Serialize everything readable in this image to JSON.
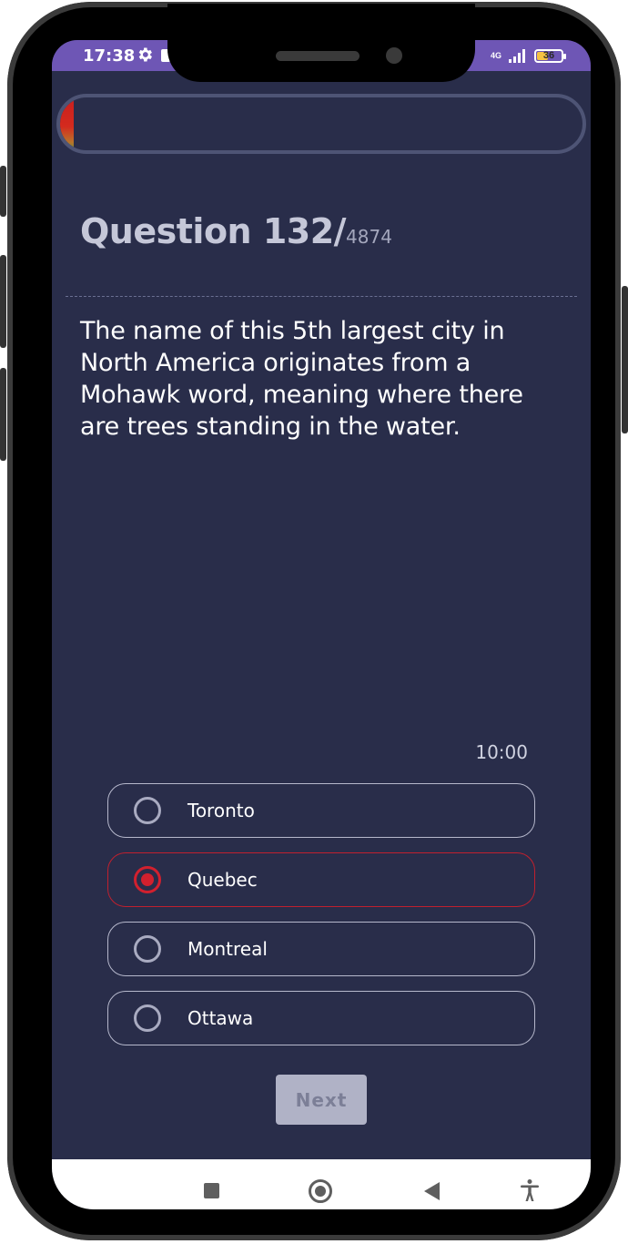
{
  "status_bar": {
    "time": "17:38",
    "network": "4G",
    "battery": "36",
    "icons": [
      "gear-icon",
      "sim-icon",
      "signal-icon",
      "battery-icon"
    ]
  },
  "progress": {
    "fraction": 0.027,
    "colors": [
      "#c91f1f",
      "#b8742a",
      "#6a8a3a"
    ]
  },
  "question": {
    "label": "Question 132/",
    "total": "4874",
    "text": "The name of this 5th largest city in North America originates from a Mohawk word, meaning where there are trees standing in the water."
  },
  "timer": "10:00",
  "options": [
    {
      "label": "Toronto",
      "selected": false
    },
    {
      "label": "Quebec",
      "selected": true
    },
    {
      "label": "Montreal",
      "selected": false
    },
    {
      "label": "Ottawa",
      "selected": false
    }
  ],
  "next_label": "Next",
  "colors": {
    "background": "#292d4a",
    "status_bar": "#6e56b5",
    "selected_accent": "#d2202e",
    "option_border": "#b6b8cc",
    "button_disabled": "#b0b2c6"
  },
  "nav_bar": {
    "icons": [
      "recents-icon",
      "home-icon",
      "back-icon",
      "accessibility-icon"
    ]
  }
}
